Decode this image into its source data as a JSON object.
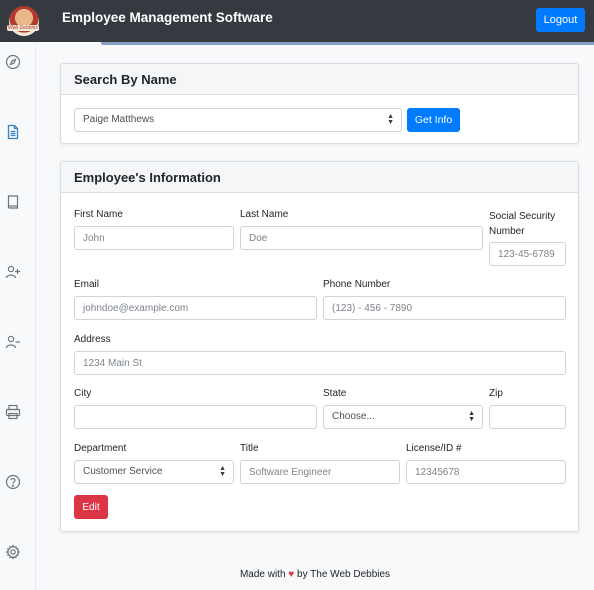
{
  "header": {
    "logo_text": "Web Debbies",
    "title": "Employee Management Software",
    "logout_label": "Logout"
  },
  "sidebar": {
    "icons": [
      "compass-icon",
      "document-icon",
      "book-icon",
      "user-plus-icon",
      "user-minus-icon",
      "printer-icon",
      "help-icon",
      "settings-icon"
    ]
  },
  "search": {
    "title": "Search By Name",
    "selected_name": "Paige Matthews",
    "button_label": "Get Info"
  },
  "employee": {
    "title": "Employee's Information",
    "first_name": {
      "label": "First Name",
      "placeholder": "John"
    },
    "last_name": {
      "label": "Last Name",
      "placeholder": "Doe"
    },
    "ssn": {
      "label": "Social Security Number",
      "placeholder": "123-45-6789"
    },
    "email": {
      "label": "Email",
      "placeholder": "johndoe@example.com"
    },
    "phone": {
      "label": "Phone Number",
      "placeholder": "(123) - 456 - 7890"
    },
    "address": {
      "label": "Address",
      "placeholder": "1234 Main St"
    },
    "city": {
      "label": "City",
      "value": ""
    },
    "state": {
      "label": "State",
      "value": "Choose..."
    },
    "zip": {
      "label": "Zip",
      "value": ""
    },
    "department": {
      "label": "Department",
      "value": "Customer Service"
    },
    "job_title": {
      "label": "Title",
      "placeholder": "Software Engineer"
    },
    "license": {
      "label": "License/ID #",
      "placeholder": "12345678"
    },
    "edit_label": "Edit"
  },
  "footer": {
    "prefix": "Made with",
    "heart": "♥",
    "suffix": "by The Web Debbies"
  }
}
